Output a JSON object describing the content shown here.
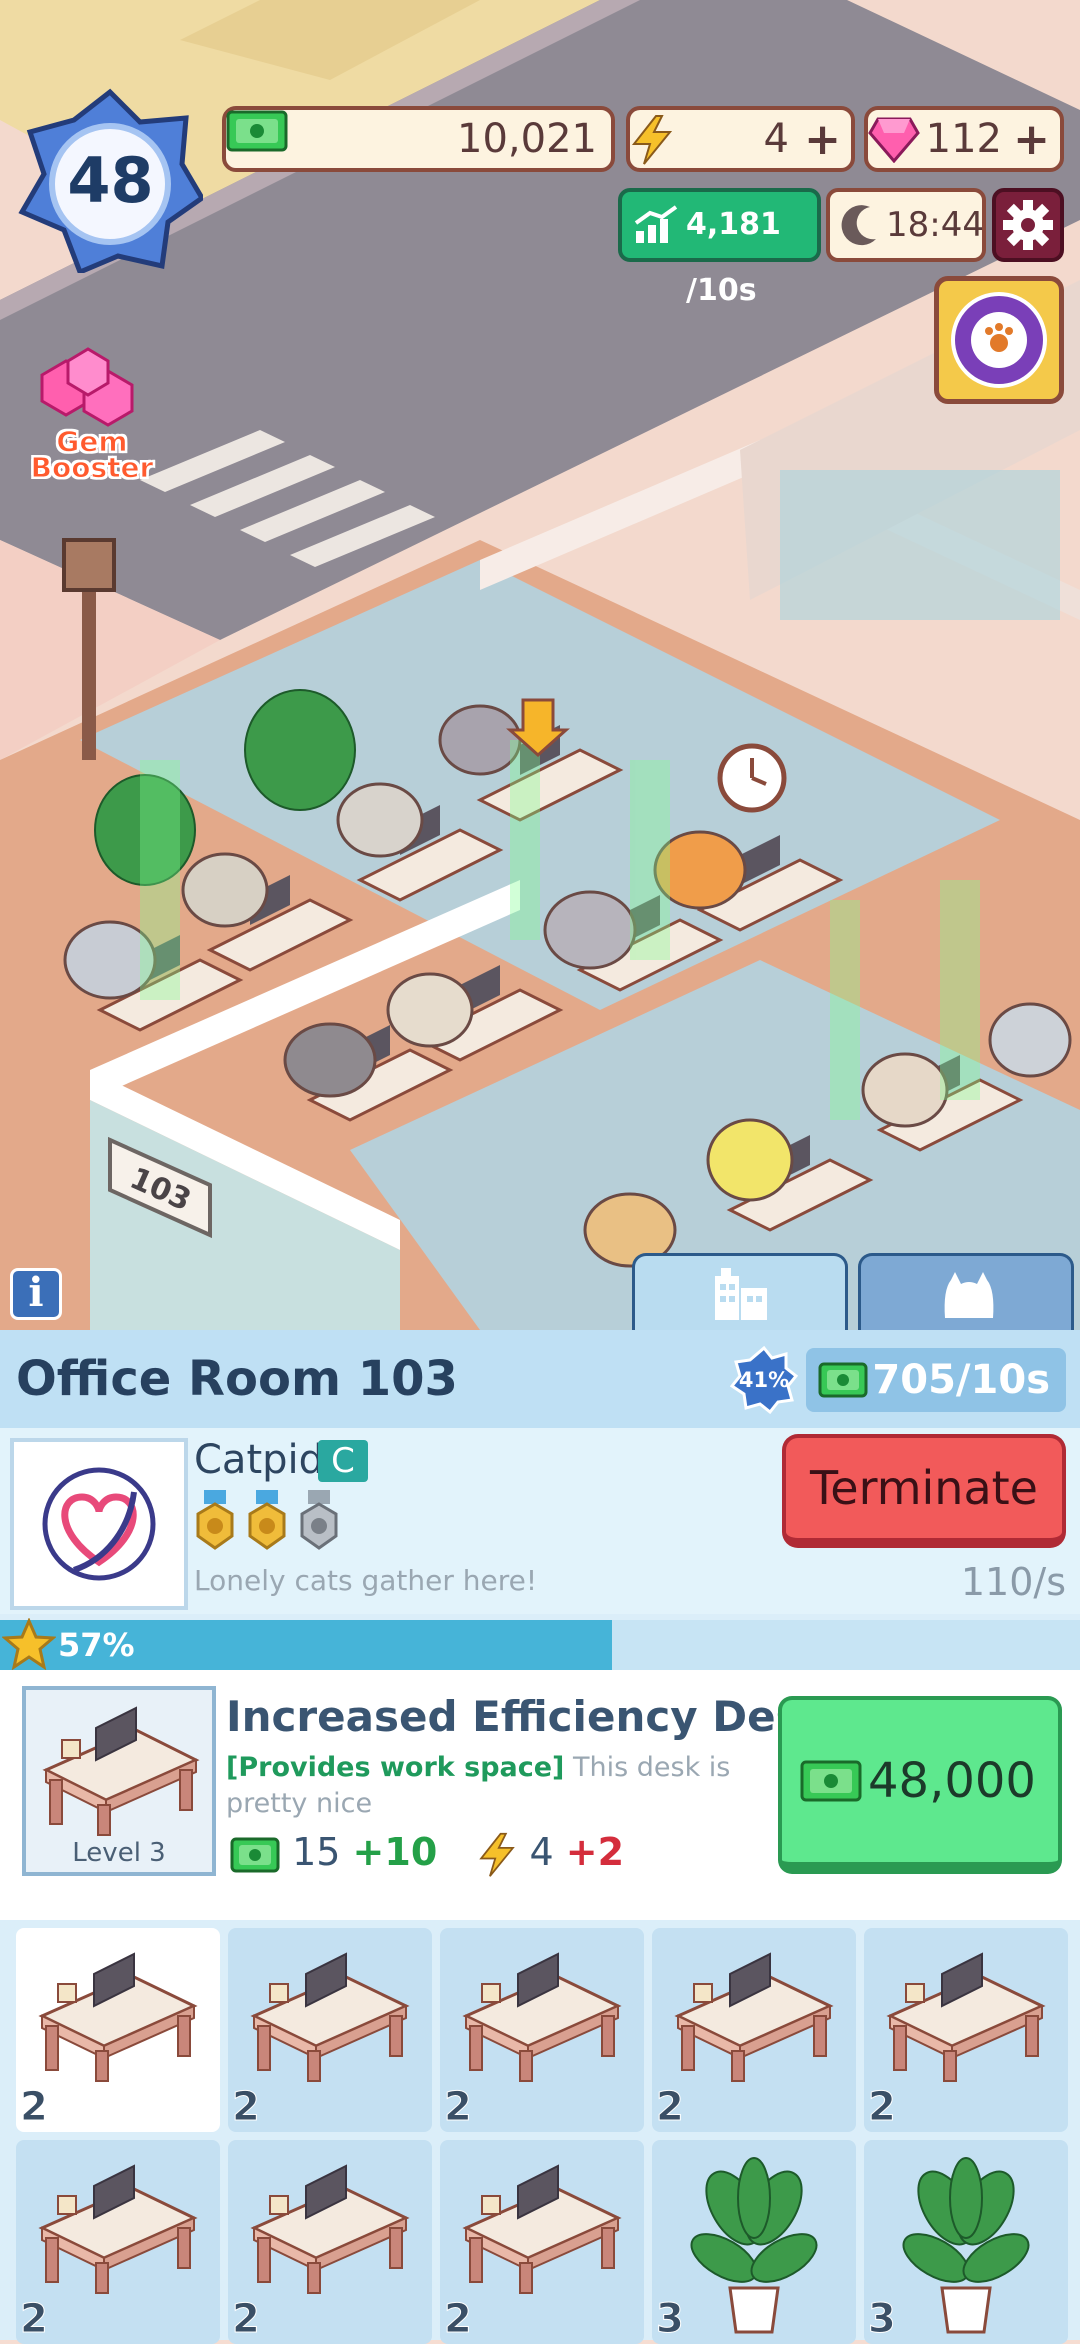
{
  "hud": {
    "level": "48",
    "cash": "10,021",
    "energy": "4",
    "gems": "112",
    "income_rate": "4,181 /10s",
    "clock": "18:44",
    "gem_booster_label": "Gem Booster",
    "info_label": "i"
  },
  "room": {
    "sign_number": "103",
    "title": "Office Room 103",
    "efficiency_pct": "41%",
    "rate": "705/10s"
  },
  "company": {
    "name": "Catpid",
    "grade": "C",
    "tagline": "Lonely cats gather here!",
    "terminate_label": "Terminate",
    "per_second": "110/s",
    "medals": [
      "gold",
      "gold",
      "silver"
    ],
    "progress_text": "57%",
    "progress_fraction": 0.57
  },
  "upgrade": {
    "title": "Increased Efficiency Desk",
    "tag": "[Provides work space]",
    "description": "This desk is pretty nice",
    "level_label": "Level 3",
    "cash_base": "15",
    "cash_bonus": "+10",
    "energy_base": "4",
    "energy_bonus": "+2",
    "price": "48,000"
  },
  "grid": [
    {
      "type": "desk",
      "count": "2",
      "selected": true
    },
    {
      "type": "desk",
      "count": "2",
      "selected": false
    },
    {
      "type": "desk",
      "count": "2",
      "selected": false
    },
    {
      "type": "desk",
      "count": "2",
      "selected": false
    },
    {
      "type": "desk",
      "count": "2",
      "selected": false
    },
    {
      "type": "desk",
      "count": "2",
      "selected": false
    },
    {
      "type": "desk",
      "count": "2",
      "selected": false
    },
    {
      "type": "desk",
      "count": "2",
      "selected": false
    },
    {
      "type": "plant",
      "count": "3",
      "selected": false
    },
    {
      "type": "plant",
      "count": "3",
      "selected": false
    }
  ],
  "colors": {
    "accent_green": "#22b876",
    "terminate_red": "#f25a5a",
    "buy_green": "#5ee88e",
    "panel_blue": "#dbeef9"
  }
}
